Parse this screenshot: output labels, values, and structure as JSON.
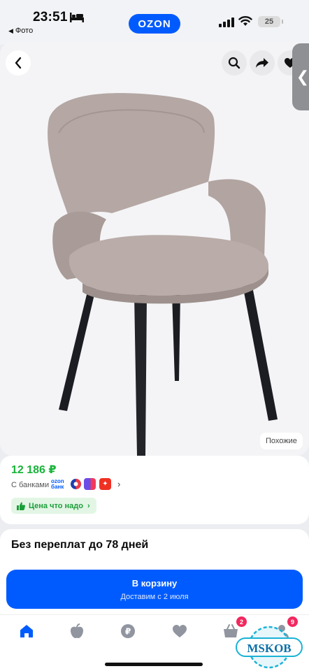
{
  "status_bar": {
    "time": "23:51",
    "back_app": "Фото",
    "battery": "25"
  },
  "header": {
    "logo": "OZON"
  },
  "product": {
    "similar_label": "Похожие",
    "price": "12 186 ₽",
    "banks_label": "С банками",
    "ozon_bank_line1": "ozon",
    "ozon_bank_line2": "банк",
    "price_chip_label": "Цена что надо"
  },
  "installment": {
    "title": "Без переплат до 78 дней"
  },
  "cart": {
    "label": "В корзину",
    "delivery": "Доставим с 2 июля"
  },
  "nav": {
    "cart_badge": "2",
    "profile_badge": "9",
    "items": [
      "home-icon",
      "catalog-icon",
      "finance-icon",
      "favorites-icon",
      "cart-icon",
      "profile-icon"
    ]
  },
  "watermark": "MSKOB",
  "colors": {
    "brand": "#005bff",
    "price": "#18b43a",
    "badge": "#f2275e",
    "chip_bg": "#e3f6e5"
  }
}
